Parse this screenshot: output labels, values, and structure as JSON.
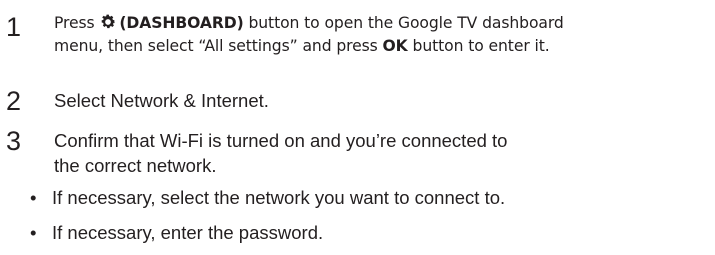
{
  "steps": [
    {
      "number": "1",
      "line1_prefix": "Press",
      "line1_button": "(DASHBOARD)",
      "line1_suffix": "button to open the Google TV dashboard",
      "line2_prefix": "menu, then select “All settings” and press",
      "line2_button": "OK",
      "line2_suffix": "button to enter it."
    },
    {
      "number": "2",
      "text": "Select Network & Internet."
    },
    {
      "number": "3",
      "line1": "Confirm that Wi-Fi is turned on and you’re connected to",
      "line2": "the correct network."
    }
  ],
  "bullets": [
    {
      "symbol": "•",
      "text": "If necessary, select the network you want to connect to."
    },
    {
      "symbol": "•",
      "text": "If necessary, enter the password."
    }
  ],
  "icons": {
    "dashboard": "gear-icon"
  }
}
